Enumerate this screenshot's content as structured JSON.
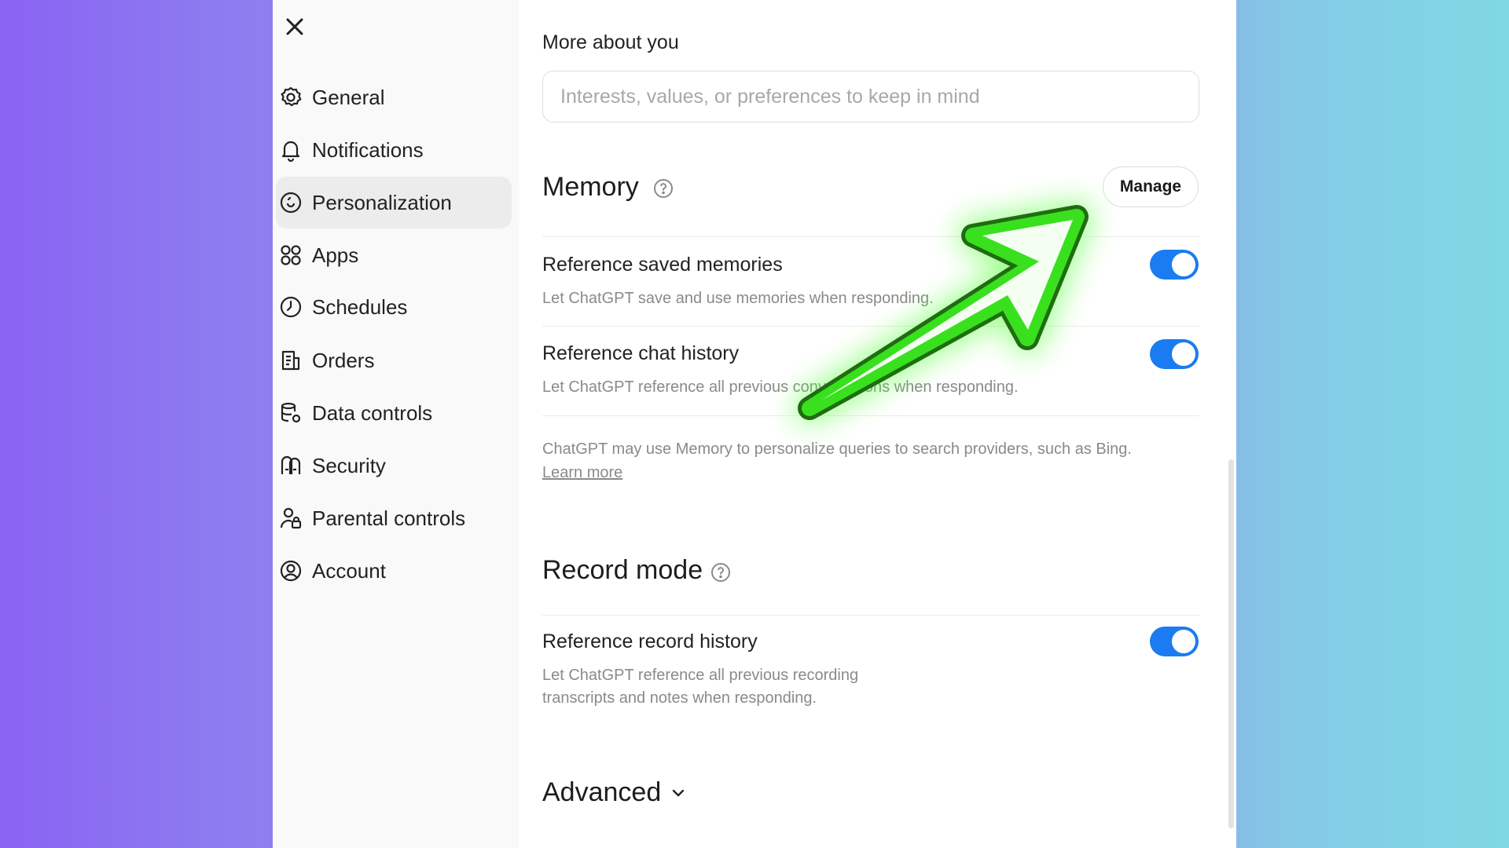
{
  "sidebar": {
    "close_icon": "close-icon",
    "items": [
      {
        "label": "General",
        "icon": "gear-icon"
      },
      {
        "label": "Notifications",
        "icon": "bell-icon"
      },
      {
        "label": "Personalization",
        "icon": "personalization-icon",
        "active": true
      },
      {
        "label": "Apps",
        "icon": "apps-grid-icon"
      },
      {
        "label": "Schedules",
        "icon": "clock-icon"
      },
      {
        "label": "Orders",
        "icon": "orders-icon"
      },
      {
        "label": "Data controls",
        "icon": "database-gear-icon"
      },
      {
        "label": "Security",
        "icon": "security-icon"
      },
      {
        "label": "Parental controls",
        "icon": "parental-controls-icon"
      },
      {
        "label": "Account",
        "icon": "account-icon"
      }
    ]
  },
  "main": {
    "more_about_you": {
      "label": "More about you",
      "value": "",
      "placeholder": "Interests, values, or preferences to keep in mind"
    },
    "memory": {
      "title": "Memory",
      "manage_label": "Manage",
      "saved_memories": {
        "title": "Reference saved memories",
        "desc": "Let ChatGPT save and use memories when responding.",
        "enabled": true
      },
      "chat_history": {
        "title": "Reference chat history",
        "desc": "Let ChatGPT reference all previous conversations when responding.",
        "enabled": true
      },
      "note": "ChatGPT may use Memory to personalize queries to search providers, such as Bing.",
      "learn_more": "Learn more"
    },
    "record_mode": {
      "title": "Record mode",
      "record_history": {
        "title": "Reference record history",
        "desc_line1": "Let ChatGPT reference all previous recording",
        "desc_line2": "transcripts and notes when responding.",
        "enabled": true
      }
    },
    "advanced": {
      "title": "Advanced"
    }
  },
  "colors": {
    "toggle_on": "#1a7cf0",
    "arrow_green": "#39e01e",
    "arrow_outline": "#1f6d10"
  }
}
